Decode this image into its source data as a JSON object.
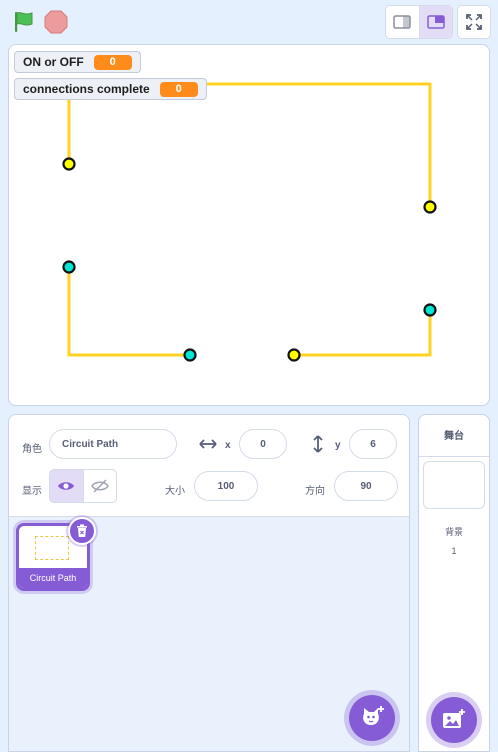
{
  "colors": {
    "accent": "#855cd6",
    "wire": "#ffd21f",
    "node_yellow": "#ffff00",
    "node_cyan": "#00e5d4",
    "monitor_value": "#ff8c1a",
    "flag": "#4cbf56",
    "stop": "#ec9c9c"
  },
  "toolbar": {
    "green_flag_icon": "green-flag-icon",
    "stop_icon": "stop-sign-icon",
    "layout_small_icon": "small-stage-layout-icon",
    "layout_normal_icon": "normal-stage-layout-icon",
    "fullscreen_icon": "fullscreen-icon"
  },
  "stage": {
    "monitors": [
      {
        "label": "ON or OFF",
        "value": "0"
      },
      {
        "label": "connections complete",
        "value": "0"
      }
    ]
  },
  "sprite_info": {
    "sprite_label": "角色",
    "sprite_name": "Circuit Path",
    "x_label": "x",
    "x_value": "0",
    "y_label": "y",
    "y_value": "6",
    "show_label": "显示",
    "size_label": "大小",
    "size_value": "100",
    "direction_label": "方向",
    "direction_value": "90"
  },
  "sprites": [
    {
      "name": "Circuit Path",
      "selected": true
    }
  ],
  "stage_panel": {
    "title": "舞台",
    "backdrops_label": "背景",
    "backdrops_count": "1"
  }
}
